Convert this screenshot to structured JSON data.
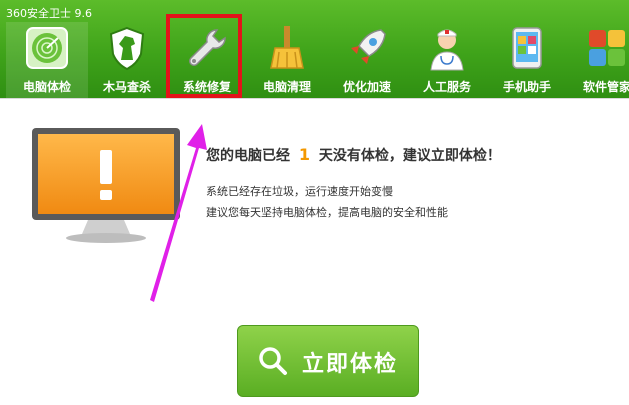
{
  "app": {
    "title": "360安全卫士 9.6"
  },
  "toolbar": {
    "items": [
      {
        "label": "电脑体检",
        "icon": "radar-icon"
      },
      {
        "label": "木马查杀",
        "icon": "horse-shield-icon"
      },
      {
        "label": "系统修复",
        "icon": "wrench-icon"
      },
      {
        "label": "电脑清理",
        "icon": "broom-icon"
      },
      {
        "label": "优化加速",
        "icon": "rocket-icon"
      },
      {
        "label": "人工服务",
        "icon": "doctor-icon"
      },
      {
        "label": "手机助手",
        "icon": "phone-app-icon"
      },
      {
        "label": "软件管家",
        "icon": "software-grid-icon"
      }
    ],
    "active_index": 0,
    "highlighted_index": 2
  },
  "main": {
    "headline_prefix": "您的电脑已经",
    "days": "1",
    "headline_suffix": "天没有体检，建议立即体检！",
    "line1": "系统已经存在垃圾，运行速度开始变慢",
    "line2": "建议您每天坚持电脑体检，提高电脑的安全和性能",
    "check_button": "立即体检"
  },
  "colors": {
    "brand_green": "#3fa31a",
    "highlight_red": "#e3131a",
    "accent_orange": "#f39800",
    "arrow_magenta": "#e020e8"
  }
}
